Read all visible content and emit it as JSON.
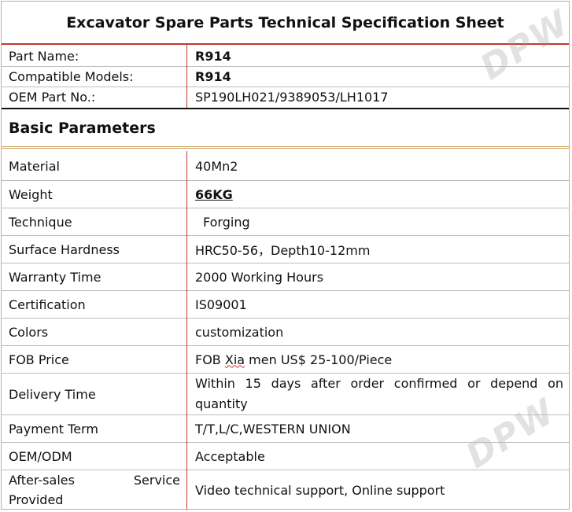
{
  "title": "Excavator Spare Parts Technical Specification Sheet",
  "watermark": "DPW",
  "top_rows": [
    {
      "label": "Part Name:",
      "value": "R914"
    },
    {
      "label": "Compatible Models:",
      "value": "R914"
    },
    {
      "label": "OEM Part No.:",
      "value": "SP190LH021/9389053/LH1017"
    }
  ],
  "section_title": "Basic Parameters",
  "params": {
    "material": {
      "label": "Material",
      "value": "40Mn2"
    },
    "weight": {
      "label": "Weight",
      "value": "66KG"
    },
    "technique": {
      "label": "Technique",
      "value": "Forging"
    },
    "hardness": {
      "label": "Surface Hardness",
      "value": "HRC50-56，Depth10-12mm"
    },
    "warranty": {
      "label": "Warranty Time",
      "value": "2000 Working Hours"
    },
    "certification": {
      "label": "Certification",
      "value": "IS09001"
    },
    "colors": {
      "label": "Colors",
      "value": "customization"
    },
    "fob": {
      "label": "FOB Price",
      "value_prefix": "FOB ",
      "value_xia": "Xia",
      "value_suffix": " men US$ 25-100/Piece"
    },
    "delivery": {
      "label": "Delivery Time",
      "value_line1": "Within 15 days after order confirmed or depend on",
      "value_line2": "quantity"
    },
    "payment": {
      "label": "Payment Term",
      "value": "T/T,L/C,WESTERN UNION"
    },
    "oem": {
      "label": "OEM/ODM",
      "value": "Acceptable"
    },
    "after_sales": {
      "label_word1": "After-sales",
      "label_word2": "Service",
      "label_word3": "Provided",
      "value": "Video technical support, Online support"
    }
  }
}
